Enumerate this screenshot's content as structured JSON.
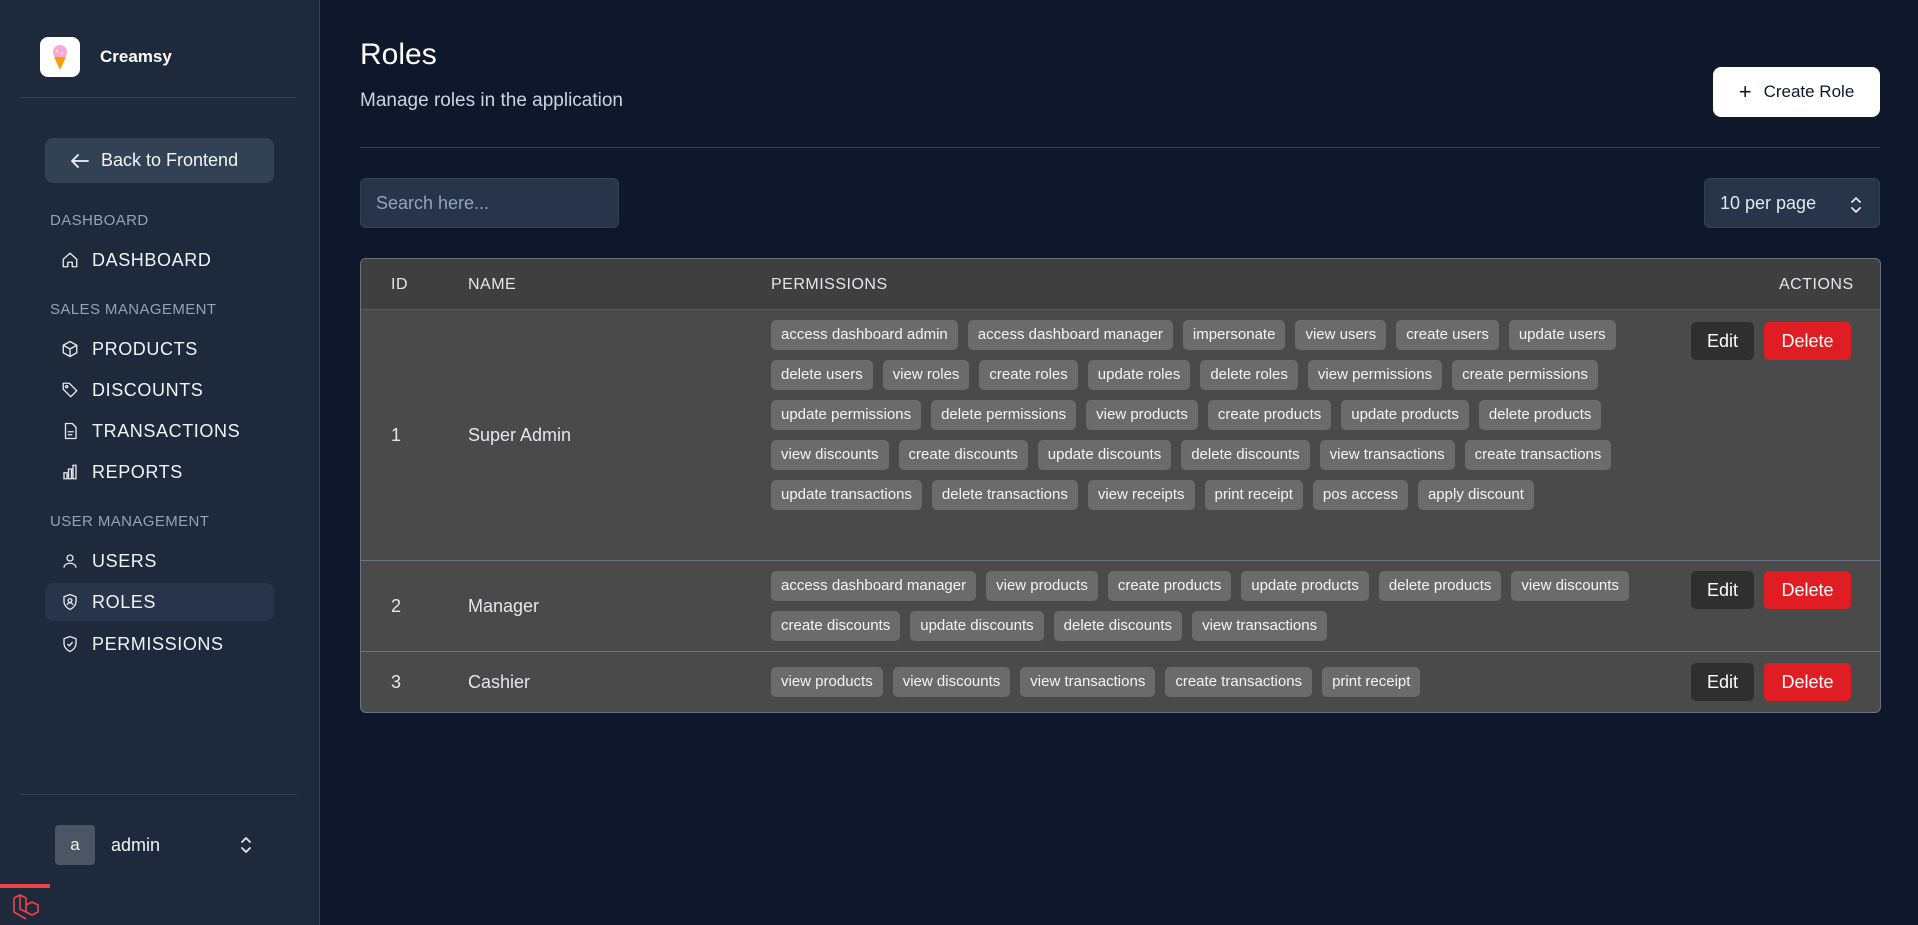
{
  "app": {
    "name": "Creamsy"
  },
  "sidebar": {
    "back_label": "Back to Frontend",
    "sections": [
      {
        "title": "DASHBOARD"
      },
      {
        "title": "SALES MANAGEMENT"
      },
      {
        "title": "USER MANAGEMENT"
      }
    ],
    "items": [
      {
        "label": "DASHBOARD",
        "icon": "home-icon"
      },
      {
        "label": "PRODUCTS",
        "icon": "cube-icon"
      },
      {
        "label": "DISCOUNTS",
        "icon": "tag-icon"
      },
      {
        "label": "TRANSACTIONS",
        "icon": "document-icon"
      },
      {
        "label": "REPORTS",
        "icon": "chart-bar-icon"
      },
      {
        "label": "USERS",
        "icon": "user-icon"
      },
      {
        "label": "ROLES",
        "icon": "shield-icon",
        "active": true
      },
      {
        "label": "PERMISSIONS",
        "icon": "shield-check-icon"
      }
    ],
    "user": {
      "initial": "a",
      "name": "admin"
    }
  },
  "header": {
    "title": "Roles",
    "subtitle": "Manage roles in the application",
    "create_label": "Create Role"
  },
  "toolbar": {
    "search_placeholder": "Search here...",
    "per_page": "10 per page"
  },
  "table": {
    "columns": {
      "id": "ID",
      "name": "NAME",
      "permissions": "PERMISSIONS",
      "actions": "ACTIONS"
    },
    "edit_label": "Edit",
    "delete_label": "Delete",
    "rows": [
      {
        "id": "1",
        "name": "Super Admin",
        "permissions": [
          "access dashboard admin",
          "access dashboard manager",
          "impersonate",
          "view users",
          "create users",
          "update users",
          "delete users",
          "view roles",
          "create roles",
          "update roles",
          "delete roles",
          "view permissions",
          "create permissions",
          "update permissions",
          "delete permissions",
          "view products",
          "create products",
          "update products",
          "delete products",
          "view discounts",
          "create discounts",
          "update discounts",
          "delete discounts",
          "view transactions",
          "create transactions",
          "update transactions",
          "delete transactions",
          "view receipts",
          "print receipt",
          "pos access",
          "apply discount"
        ]
      },
      {
        "id": "2",
        "name": "Manager",
        "permissions": [
          "access dashboard manager",
          "view products",
          "create products",
          "update products",
          "delete products",
          "view discounts",
          "create discounts",
          "update discounts",
          "delete discounts",
          "view transactions"
        ]
      },
      {
        "id": "3",
        "name": "Cashier",
        "permissions": [
          "view products",
          "view discounts",
          "view transactions",
          "create transactions",
          "print receipt"
        ]
      }
    ]
  },
  "colors": {
    "background": "#0f172a",
    "sidebar": "#1e293b",
    "delete": "#e11d24",
    "accent_bar": "#ef4444"
  }
}
